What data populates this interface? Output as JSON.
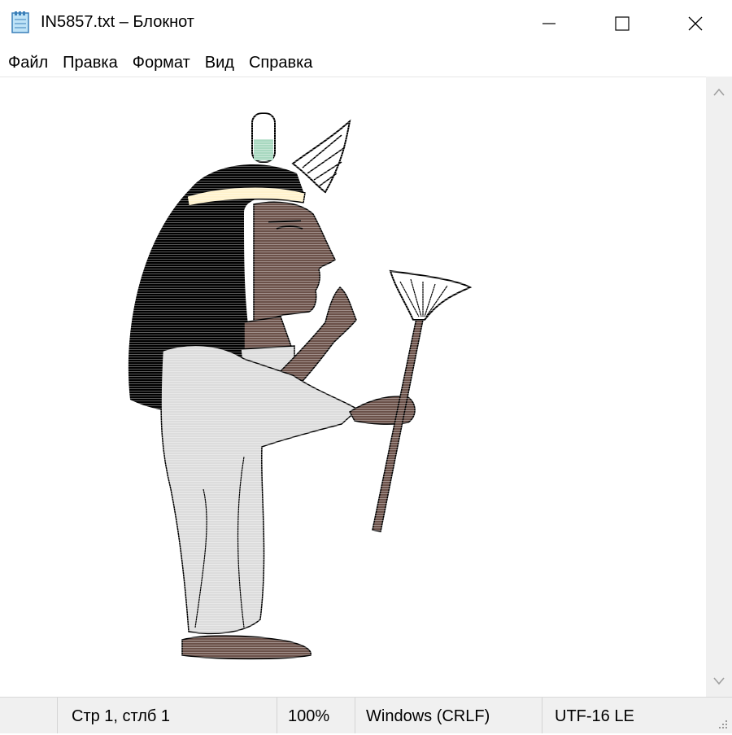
{
  "window": {
    "title": "IN5857.txt – Блокнот",
    "icon": "notepad-icon",
    "controls": [
      "minimize-icon",
      "maximize-icon",
      "close-icon"
    ]
  },
  "menu": {
    "items": [
      {
        "label": "Файл"
      },
      {
        "label": "Правка"
      },
      {
        "label": "Формат"
      },
      {
        "label": "Вид"
      },
      {
        "label": "Справка"
      }
    ]
  },
  "editor": {
    "content": "ASCII-art figure of an Egyptian woman holding a fan"
  },
  "status": {
    "position": "Стр 1, стлб 1",
    "zoom": "100%",
    "line_endings": "Windows (CRLF)",
    "encoding": "UTF-16 LE"
  },
  "colors": {
    "hair": "#000000",
    "skin": "#6b5149",
    "dress": "#dcdcdc",
    "fan_head": "#ffffff",
    "crown_tip": "#a8d8c0",
    "status_bg": "#f0f0f0"
  }
}
